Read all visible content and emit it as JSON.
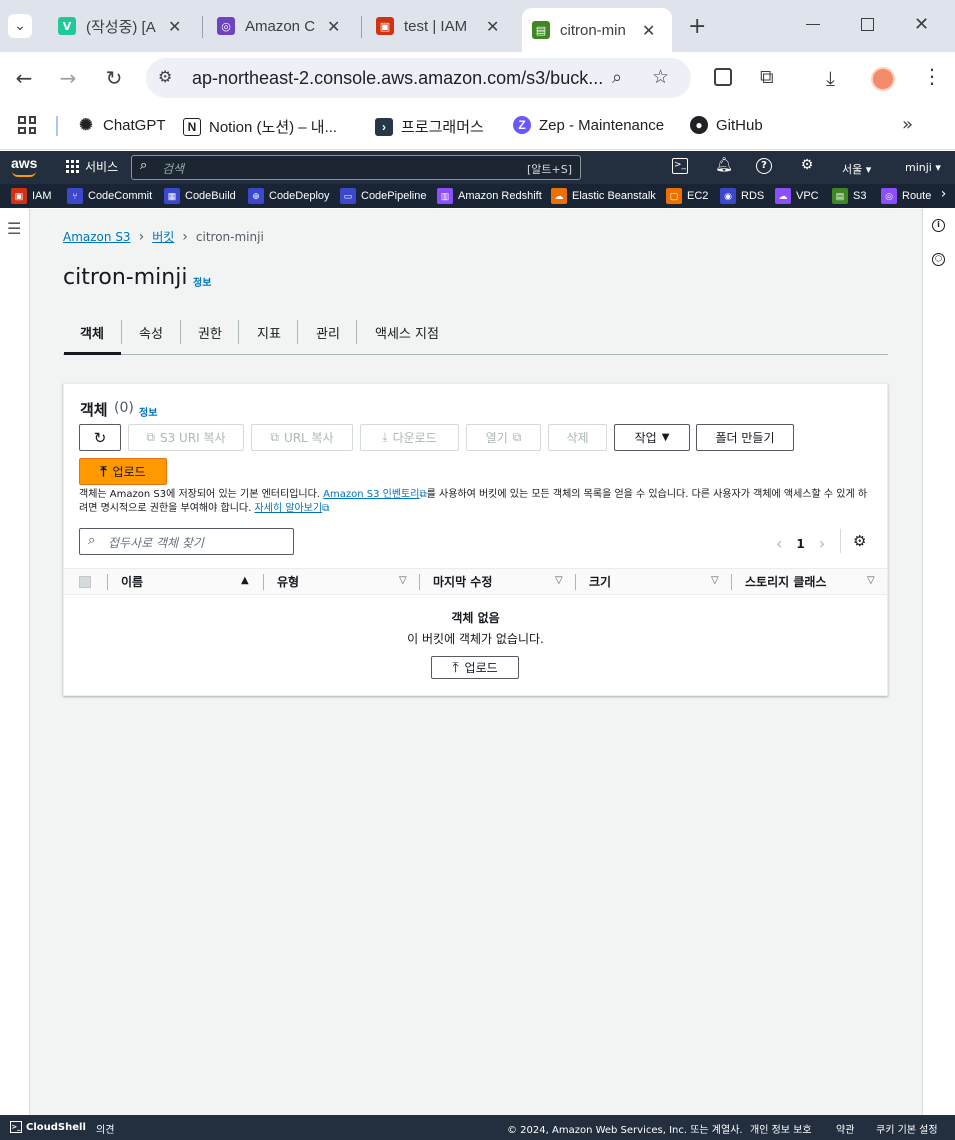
{
  "browser": {
    "tabs": [
      {
        "title": "(작성중) [A",
        "favicon": "V",
        "color": "#20c997"
      },
      {
        "title": "Amazon C",
        "favicon": "◎",
        "color": "#6f42c1"
      },
      {
        "title": "test | IAM",
        "favicon": "▣",
        "color": "#d13212"
      },
      {
        "title": "citron-min",
        "favicon": "▤",
        "color": "#3f8624"
      }
    ],
    "url": "ap-northeast-2.console.aws.amazon.com/s3/buck...",
    "bookmarks": [
      "ChatGPT",
      "Notion (노션) – 내...",
      "프로그래머스",
      "Zep - Maintenance",
      "GitHub"
    ]
  },
  "aws": {
    "logo": "aws",
    "services_label": "서비스",
    "search_placeholder": "검색",
    "search_shortcut": "[알트+S]",
    "region": "서울 ▾",
    "user": "minji ▾",
    "favorites": [
      {
        "label": "IAM",
        "color": "#d13212"
      },
      {
        "label": "CodeCommit",
        "color": "#3b48cc"
      },
      {
        "label": "CodeBuild",
        "color": "#3b48cc"
      },
      {
        "label": "CodeDeploy",
        "color": "#3b48cc"
      },
      {
        "label": "CodePipeline",
        "color": "#3b48cc"
      },
      {
        "label": "Amazon Redshift",
        "color": "#8c4fff"
      },
      {
        "label": "Elastic Beanstalk",
        "color": "#ed7100"
      },
      {
        "label": "EC2",
        "color": "#ed7100"
      },
      {
        "label": "RDS",
        "color": "#3b48cc"
      },
      {
        "label": "VPC",
        "color": "#8c4fff"
      },
      {
        "label": "S3",
        "color": "#3f8624"
      },
      {
        "label": "Route",
        "color": "#8c4fff"
      }
    ]
  },
  "breadcrumb": {
    "root": "Amazon S3",
    "section": "버킷",
    "current": "citron-minji"
  },
  "page": {
    "title": "citron-minji",
    "info": "정보"
  },
  "tabs": [
    "객체",
    "속성",
    "권한",
    "지표",
    "관리",
    "액세스 지점"
  ],
  "objects": {
    "title": "객체",
    "count": "(0)",
    "info": "정보",
    "buttons": {
      "s3uri": "S3 URI 복사",
      "url": "URL 복사",
      "download": "다운로드",
      "open": "열기",
      "delete": "삭제",
      "actions": "작업",
      "create_folder": "폴더 만들기",
      "upload": "업로드"
    },
    "desc_1": "객체는 Amazon S3에 저장되어 있는 기본 엔터티입니다.",
    "desc_link1": "Amazon S3 인벤토리",
    "desc_2": "를 사용하여 버킷에 있는 모든 객체의 목록을 얻을 수 있습니다. 다른 사용자가 객체에 액세스할 수 있게 하려면 명시적으로 권한을 부여해야 합니다.",
    "desc_link2": "자세히 알아보기",
    "filter_placeholder": "접두사로 객체 찾기",
    "page": "1",
    "columns": [
      "이름",
      "유형",
      "마지막 수정",
      "크기",
      "스토리지 클래스"
    ],
    "empty_title": "객체 없음",
    "empty_desc": "이 버킷에 객체가 없습니다.",
    "empty_upload": "업로드"
  },
  "footer": {
    "cloudshell": "CloudShell",
    "feedback": "의견",
    "copyright": "© 2024, Amazon Web Services, Inc. 또는 계열사.",
    "privacy": "개인 정보 보호",
    "terms": "약관",
    "cookies": "쿠키 기본 설정"
  }
}
